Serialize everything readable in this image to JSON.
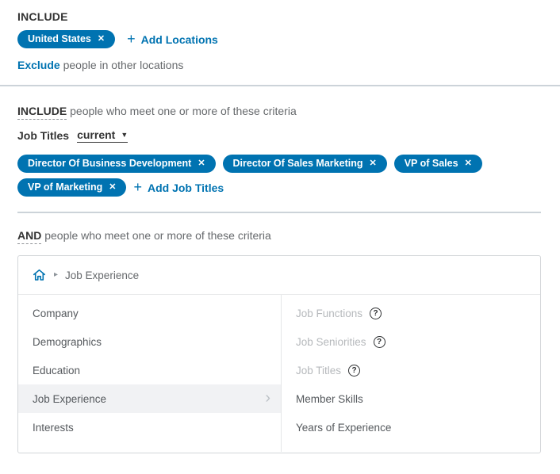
{
  "ui": {
    "remove_symbol": "✕",
    "plus_symbol": "+",
    "caret_down": "▼",
    "chevron_right": "›",
    "breadcrumb_separator": "▸",
    "help_symbol": "?"
  },
  "colors": {
    "accent_blue": "#0073b1",
    "pill_background": "#0073b1",
    "divider": "#ccd3d9",
    "selected_row_background": "#f1f2f4",
    "disabled_text": "#b6b9bc"
  },
  "location_filter": {
    "header_label": "INCLUDE",
    "pills": [
      "United States"
    ],
    "add_link_label": "Add Locations",
    "exclude_link_label": "Exclude",
    "exclude_suffix": "people in other locations"
  },
  "job_titles_filter": {
    "operator_label": "INCLUDE",
    "operator_suffix": "people who meet one or more of these criteria",
    "field_label": "Job Titles",
    "scope_dropdown_value": "current",
    "pills": [
      "Director Of Business Development",
      "Director Of Sales Marketing",
      "VP of Sales",
      "VP of Marketing"
    ],
    "add_link_label": "Add Job Titles"
  },
  "and_filter": {
    "operator_label": "AND",
    "operator_suffix": "people who meet one or more of these criteria",
    "attribute_picker": {
      "breadcrumb_current": "Job Experience",
      "categories": [
        {
          "label": "Company",
          "selected": false
        },
        {
          "label": "Demographics",
          "selected": false
        },
        {
          "label": "Education",
          "selected": false
        },
        {
          "label": "Job Experience",
          "selected": true
        },
        {
          "label": "Interests",
          "selected": false
        }
      ],
      "attributes": [
        {
          "label": "Job Functions",
          "disabled": true,
          "has_help": true
        },
        {
          "label": "Job Seniorities",
          "disabled": true,
          "has_help": true
        },
        {
          "label": "Job Titles",
          "disabled": true,
          "has_help": true
        },
        {
          "label": "Member Skills",
          "disabled": false,
          "has_help": false
        },
        {
          "label": "Years of Experience",
          "disabled": false,
          "has_help": false
        }
      ]
    }
  }
}
